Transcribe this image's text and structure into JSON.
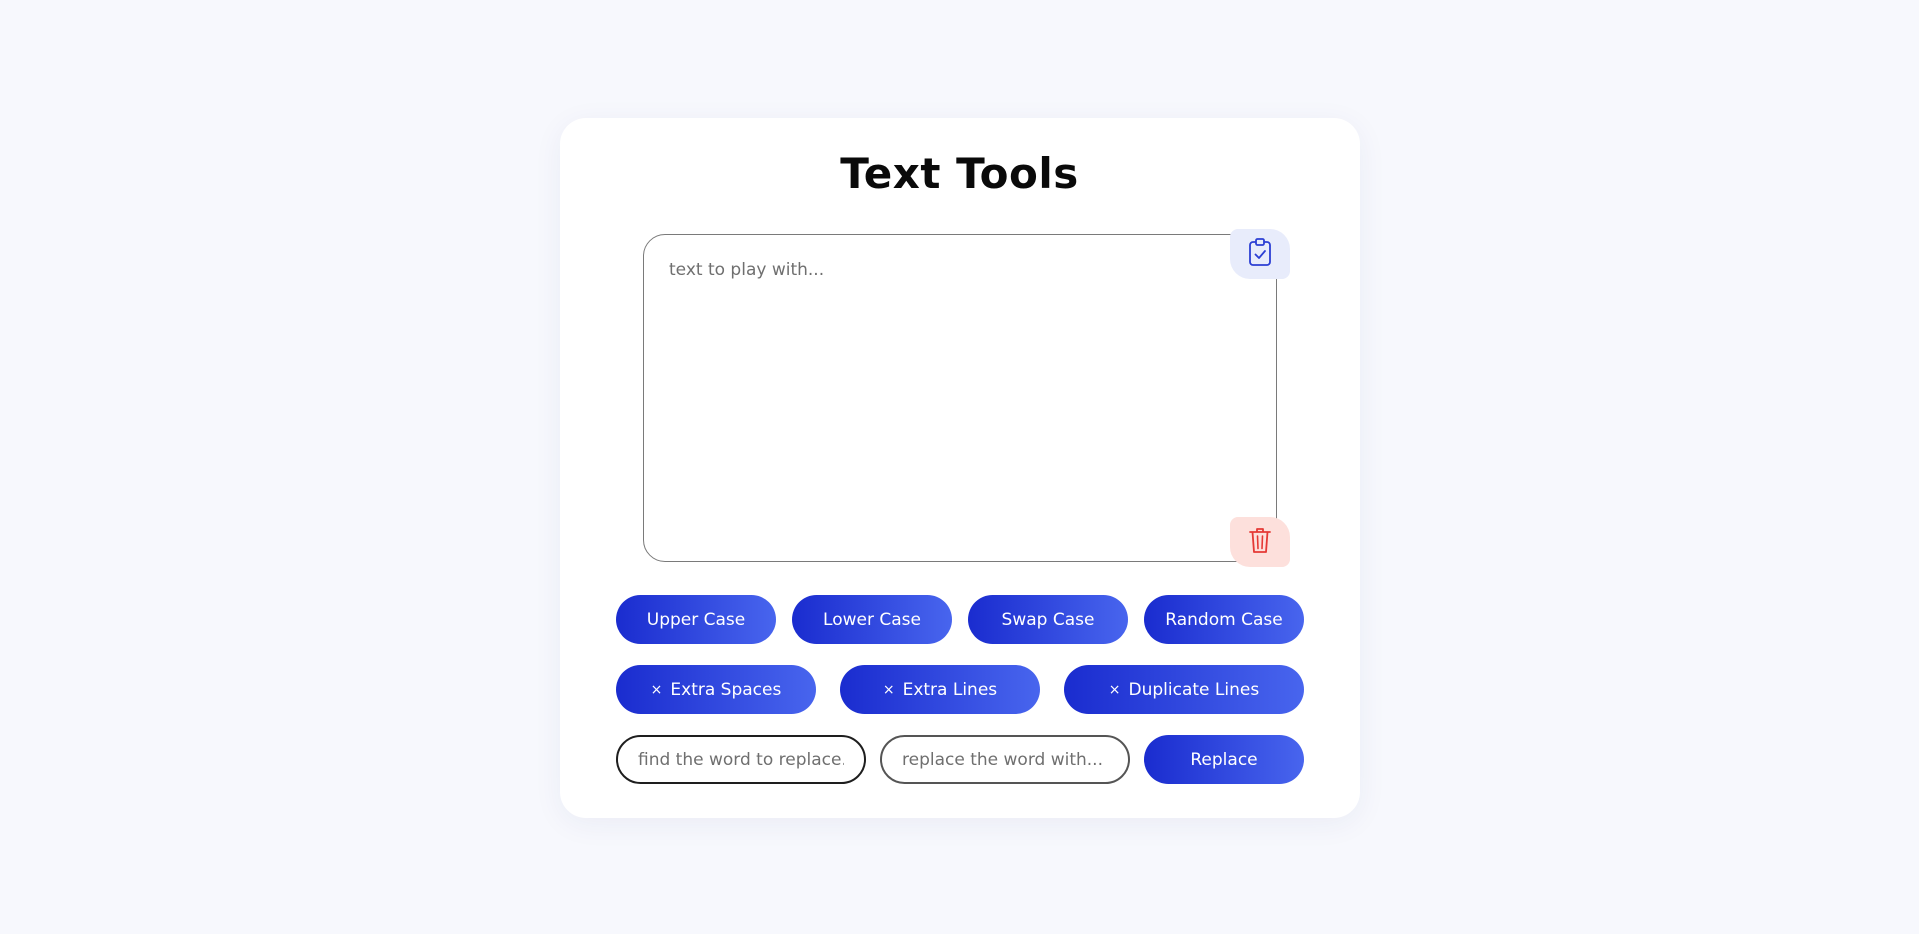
{
  "app": {
    "title": "Text Tools"
  },
  "editor": {
    "placeholder": "text to play with...",
    "value": ""
  },
  "icons": {
    "copy": "clipboard-check-icon",
    "clear": "trash-icon"
  },
  "case_buttons": [
    {
      "label": "Upper Case"
    },
    {
      "label": "Lower Case"
    },
    {
      "label": "Swap Case"
    },
    {
      "label": "Random Case"
    }
  ],
  "remove_buttons": [
    {
      "prefix": "×",
      "label": "Extra Spaces"
    },
    {
      "prefix": "×",
      "label": "Extra Lines"
    },
    {
      "prefix": "×",
      "label": "Duplicate Lines"
    }
  ],
  "replace": {
    "find_placeholder": "find the word to replace...",
    "with_placeholder": "replace the word with...",
    "button_label": "Replace"
  },
  "colors": {
    "accent_start": "#1a2ccf",
    "accent_end": "#4865ee",
    "copy_bg": "#e8ecfb",
    "clear_bg": "#fde0dc",
    "danger": "#e53935",
    "page_bg": "#f7f8fd"
  }
}
